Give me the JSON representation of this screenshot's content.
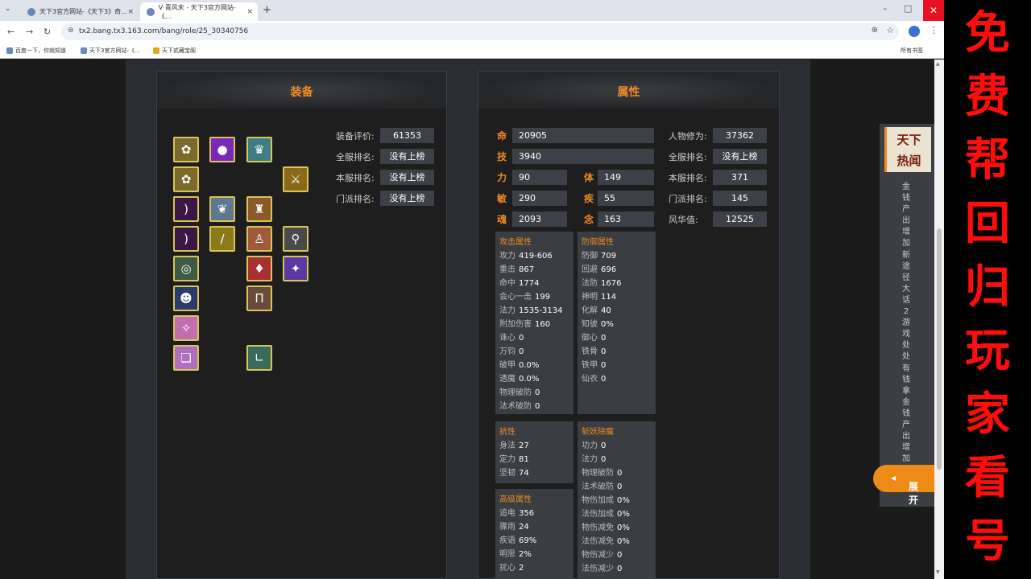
{
  "browser": {
    "tabs": [
      {
        "label": "天下3官方网站-《天下3》奇…",
        "close": "×"
      },
      {
        "label": "V·青风末 - 天下3官方网站-《…",
        "close": "×"
      }
    ],
    "tab_menu": "⌄",
    "new_tab": "+",
    "url": "tx2.bang.tx3.163.com/bang/role/25_30340756",
    "bookmarks": [
      "百度一下，你就知道",
      "天下3官方网站-《…",
      "天下贰藏宝阁"
    ],
    "all_bookmarks": "所有书签",
    "icons": {
      "back": "arrow-left-icon",
      "forward": "arrow-right-icon",
      "reload": "reload-icon",
      "zoom": "zoom-icon",
      "star": "star-icon",
      "profile": "profile-icon",
      "menu": "kebab-menu-icon"
    }
  },
  "equip": {
    "title": "装备",
    "rows": [
      {
        "label": "装备评价:",
        "value": "61353"
      },
      {
        "label": "全服排名:",
        "value": "没有上榜"
      },
      {
        "label": "本服排名:",
        "value": "没有上榜"
      },
      {
        "label": "门派排名:",
        "value": "没有上榜"
      }
    ],
    "slots": [
      {
        "icon": "flower-icon",
        "glyph": "✿",
        "color": "#7b6a2c"
      },
      {
        "icon": "purple-orb-icon",
        "glyph": "●",
        "color": "#7a28b8"
      },
      {
        "icon": "helmet-icon",
        "glyph": "♛",
        "color": "#3f7d86"
      },
      {
        "icon": "flower-icon",
        "glyph": "✿",
        "color": "#7b6a2c"
      },
      {
        "icon": "crossed-swords-icon",
        "glyph": "⚔",
        "color": "#8a6a1a"
      },
      {
        "icon": "bow-icon",
        "glyph": ")",
        "color": "#3a1846"
      },
      {
        "icon": "wing-icon",
        "glyph": "❦",
        "color": "#5f7890"
      },
      {
        "icon": "armor-icon",
        "glyph": "♜",
        "color": "#8a5a2a"
      },
      {
        "icon": "bow-icon",
        "glyph": ")",
        "color": "#3a1846"
      },
      {
        "icon": "sword-icon",
        "glyph": "/",
        "color": "#8a7a1a"
      },
      {
        "icon": "robe-icon",
        "glyph": "♙",
        "color": "#a05a3a"
      },
      {
        "icon": "magnifier-icon",
        "glyph": "⚲",
        "color": "#4a4a4a"
      },
      {
        "icon": "ring-icon",
        "glyph": "◎",
        "color": "#3e5a45"
      },
      {
        "icon": "cape-icon",
        "glyph": "♦",
        "color": "#a83030"
      },
      {
        "icon": "amulet-icon",
        "glyph": "✦",
        "color": "#5a3aa0"
      },
      {
        "icon": "mask-icon",
        "glyph": "☻",
        "color": "#2a3a6a"
      },
      {
        "icon": "pants-icon",
        "glyph": "Π",
        "color": "#6a4a3a"
      },
      {
        "icon": "pink-charm-icon",
        "glyph": "✧",
        "color": "#c070b0"
      },
      {
        "icon": "scroll-icon",
        "glyph": "❏",
        "color": "#b070c0"
      },
      {
        "icon": "boots-icon",
        "glyph": "∟",
        "color": "#3a6a5a"
      }
    ]
  },
  "attr": {
    "title": "属性",
    "ming": {
      "ch": "命",
      "value": "20905"
    },
    "ji": {
      "ch": "技",
      "value": "3940"
    },
    "li": {
      "ch": "力",
      "value": "90"
    },
    "ti": {
      "ch": "体",
      "value": "149"
    },
    "min": {
      "ch": "敏",
      "value": "290"
    },
    "ji2": {
      "ch": "疾",
      "value": "55"
    },
    "hun": {
      "ch": "魂",
      "value": "2093"
    },
    "nian": {
      "ch": "念",
      "value": "163"
    },
    "right": [
      {
        "label": "人物修为:",
        "value": "37362"
      },
      {
        "label": "全服排名:",
        "value": "没有上榜"
      },
      {
        "label": "本服排名:",
        "value": "371"
      },
      {
        "label": "门派排名:",
        "value": "145"
      },
      {
        "label": "风华值:",
        "value": "12525"
      }
    ],
    "attack": {
      "title": "攻击属性",
      "lines": [
        {
          "k": "攻力",
          "v": "419-606"
        },
        {
          "k": "重击",
          "v": "867"
        },
        {
          "k": "命中",
          "v": "1774"
        },
        {
          "k": "会心一击",
          "v": "199"
        },
        {
          "k": "法力",
          "v": "1535-3134"
        },
        {
          "k": "附加伤害",
          "v": "160"
        },
        {
          "k": "诛心",
          "v": "0"
        },
        {
          "k": "万钧",
          "v": "0"
        },
        {
          "k": "破甲",
          "v": "0.0%"
        },
        {
          "k": "透魔",
          "v": "0.0%"
        },
        {
          "k": "物理破防",
          "v": "0"
        },
        {
          "k": "法术破防",
          "v": "0"
        }
      ]
    },
    "defense": {
      "title": "防御属性",
      "lines": [
        {
          "k": "防御",
          "v": "709"
        },
        {
          "k": "回避",
          "v": "696"
        },
        {
          "k": "法防",
          "v": "1676"
        },
        {
          "k": "神明",
          "v": "114"
        },
        {
          "k": "化解",
          "v": "40"
        },
        {
          "k": "知彼",
          "v": "0%"
        },
        {
          "k": "御心",
          "v": "0"
        },
        {
          "k": "铁骨",
          "v": "0"
        },
        {
          "k": "铁甲",
          "v": "0"
        },
        {
          "k": "仙衣",
          "v": "0"
        }
      ]
    },
    "resist": {
      "title": "抗性",
      "lines": [
        {
          "k": "身法",
          "v": "27"
        },
        {
          "k": "定力",
          "v": "81"
        },
        {
          "k": "坚韧",
          "v": "74"
        }
      ]
    },
    "advanced": {
      "title": "高级属性",
      "lines": [
        {
          "k": "追电",
          "v": "356"
        },
        {
          "k": "骤雨",
          "v": "24"
        },
        {
          "k": "疾语",
          "v": "69%"
        },
        {
          "k": "明思",
          "v": "2%"
        },
        {
          "k": "扰心",
          "v": "2"
        }
      ]
    },
    "demon": {
      "title": "斩妖除魔",
      "lines": [
        {
          "k": "功力",
          "v": "0"
        },
        {
          "k": "法力",
          "v": "0"
        },
        {
          "k": "物理破防",
          "v": "0"
        },
        {
          "k": "法术破防",
          "v": "0"
        },
        {
          "k": "物伤加成",
          "v": "0%"
        },
        {
          "k": "法伤加成",
          "v": "0%"
        },
        {
          "k": "物伤减免",
          "v": "0%"
        },
        {
          "k": "法伤减免",
          "v": "0%"
        },
        {
          "k": "物伤减少",
          "v": "0"
        },
        {
          "k": "法伤减少",
          "v": "0"
        }
      ]
    }
  },
  "side": {
    "head1": "天下",
    "head2": "热闻",
    "text": "金钱产出增加新途径大话2游戏处处有钱拿金钱产出增加",
    "expand": "展开"
  },
  "promo": {
    "text": "免费帮回归玩家看号",
    "color": "#ff0d0d"
  }
}
